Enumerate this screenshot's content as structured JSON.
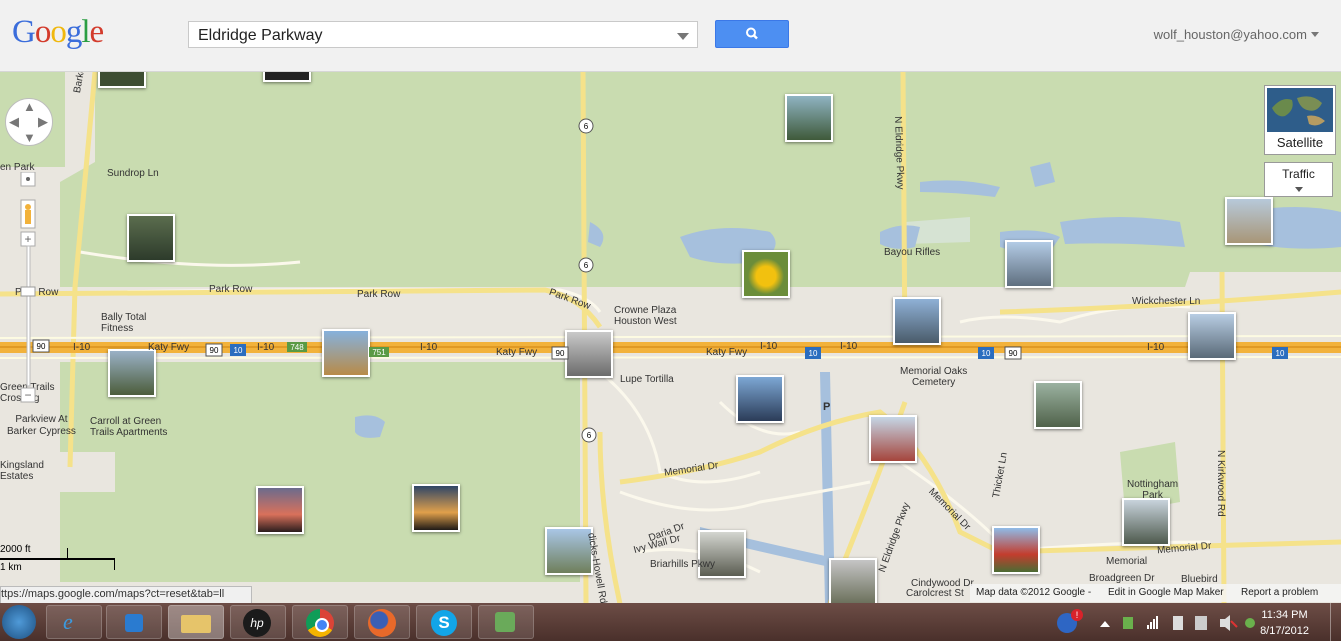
{
  "header": {
    "logo_text": "Google",
    "search_value": "Eldridge Parkway",
    "account": "wolf_houston@yahoo.com"
  },
  "map": {
    "labels": {
      "sundrop": "Sundrop Ln",
      "barker_cypress": "Barker Cypress",
      "park_row_1": "Park Row",
      "park_row_2": "Park Row",
      "park_row_3": "Park Row",
      "park_row_4": "Park Row",
      "bally": "Bally Total\nFitness",
      "katy_fwy_1": "Katy Fwy",
      "katy_fwy_2": "Katy Fwy",
      "katy_fwy_3": "Katy Fwy",
      "i10_1": "I-10",
      "i10_2": "I-10",
      "i10_3": "I-10",
      "i10_4": "I-10",
      "i10_5": "I-10",
      "i10_6": "I-10",
      "crowne": "Crowne Plaza\nHouston West",
      "lupe": "Lupe Tortilla",
      "green_trails": "Green Trails\nCrossing",
      "parkview": "Parkview At\nBarker Cypress",
      "carroll": "Carroll at Green\nTrails Apartments",
      "kingsland": "Kingsland\nEstates",
      "bayou": "Bayou Rifles",
      "n_eldridge": "N Eldridge Pkwy",
      "n_eldridge_2": "N Eldridge Pkwy",
      "memorial_oaks": "Memorial Oaks\nCemetery",
      "memorial_dr_1": "Memorial Dr",
      "memorial_dr_2": "Memorial Dr",
      "memorial_dr_3": "Memorial Dr",
      "wickchester": "Wickchester Ln",
      "nottingham": "Nottingham\nPark",
      "memorial": "Memorial",
      "broadgreen": "Broadgreen Dr",
      "bluebird": "Bluebird",
      "n_kirkwood": "N Kirkwood Rd",
      "dairy_ashford": "Dairy Ashford Rd",
      "daria": "Daria Dr",
      "ivy_wall": "Ivy Wall Dr",
      "briarhills": "Briarhills Pkwy",
      "cindywood": "Cindywood Dr",
      "carolcrest": "Carolcrest St",
      "thicket": "Thicket Ln",
      "en_park": "en Park",
      "dicks_howell": "dicks-Howell Rd",
      "p": "P"
    },
    "shields": {
      "six_a": "6",
      "six_b": "6",
      "six_c": "6",
      "ninety_a": "90",
      "ninety_b": "90",
      "ninety_c": "90",
      "ninety_d": "90",
      "ten_a": "10",
      "ten_b": "10",
      "ten_c": "10",
      "ten_d": "10",
      "ten_e": "10",
      "s748": "748",
      "s751": "751"
    },
    "satellite_label": "Satellite",
    "traffic_label": "Traffic",
    "scale": {
      "imperial": "2000 ft",
      "metric": "1 km"
    },
    "footer": {
      "map_data": "Map data ©2012 Google -",
      "edit": "Edit in Google Map Maker",
      "report": "Report a problem"
    },
    "status_url": "ttps://maps.google.com/maps?ct=reset&tab=ll"
  },
  "taskbar": {
    "time": "11:34 PM",
    "date": "8/17/2012",
    "apps": [
      "start-icon",
      "ie-icon",
      "media-icon",
      "explorer-icon",
      "hp-icon",
      "chrome-icon",
      "firefox-icon",
      "skype-icon",
      "network-icon"
    ]
  },
  "colors": {
    "park": "#c7dcab",
    "water": "#a5bfdd",
    "highway": "#f2b43c",
    "road": "#fcf8c6",
    "accent": "#4d8ff2"
  }
}
